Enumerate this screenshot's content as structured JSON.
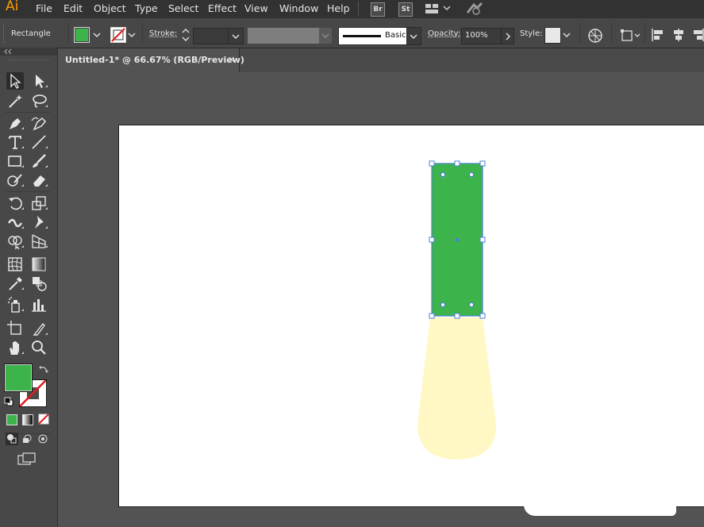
{
  "app": {
    "logo": "Ai"
  },
  "menus": [
    "File",
    "Edit",
    "Object",
    "Type",
    "Select",
    "Effect",
    "View",
    "Window",
    "Help"
  ],
  "menubar_icons": {
    "bridge": "Br",
    "stock": "St",
    "workspace_icon": "workspace-grid-icon",
    "gpu_icon": "gpu-performance-icon"
  },
  "control_bar": {
    "selection_label": "Rectangle",
    "fill_color": "#3cb44b",
    "stroke_label": "Stroke:",
    "brush_label": "Basic",
    "opacity_label": "Opacity:",
    "opacity_value": "100%",
    "style_label": "Style:"
  },
  "document": {
    "tab_title": "Untitled-1* @ 66.67% (RGB/Preview)",
    "close_glyph": "×"
  },
  "artwork": {
    "selected_rect_fill": "#3cb44b",
    "selection_color": "#4a7fd6",
    "glow_fill": "#fff8c4"
  },
  "toolbar": {
    "fill_swatch": "#3cb44b",
    "tools": [
      "selection",
      "direct-selection",
      "magic-wand",
      "lasso",
      "pen",
      "curvature",
      "type",
      "line-segment",
      "rectangle",
      "paintbrush",
      "shaper",
      "eraser",
      "rotate",
      "scale",
      "width",
      "puppet-warp",
      "shape-builder",
      "perspective-grid",
      "mesh",
      "gradient",
      "eyedropper",
      "blend",
      "symbol-sprayer",
      "column-graph",
      "artboard",
      "slice",
      "hand",
      "zoom"
    ]
  }
}
